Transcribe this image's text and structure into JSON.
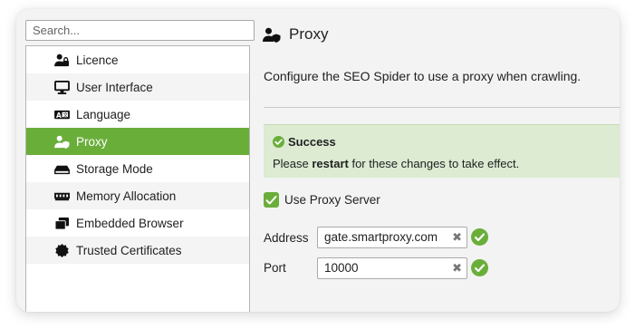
{
  "search": {
    "placeholder": "Search..."
  },
  "sidebar": {
    "items": [
      {
        "label": "Licence",
        "icon": "licence-icon"
      },
      {
        "label": "User Interface",
        "icon": "monitor-icon"
      },
      {
        "label": "Language",
        "icon": "language-icon"
      },
      {
        "label": "Proxy",
        "icon": "proxy-icon",
        "active": true
      },
      {
        "label": "Storage Mode",
        "icon": "storage-icon"
      },
      {
        "label": "Memory Allocation",
        "icon": "memory-icon"
      },
      {
        "label": "Embedded Browser",
        "icon": "browser-icon"
      },
      {
        "label": "Trusted Certificates",
        "icon": "certificate-icon"
      }
    ]
  },
  "main": {
    "title": "Proxy",
    "description": "Configure the SEO Spider to use a proxy when crawling.",
    "alert": {
      "title": "Success",
      "message_prefix": "Please ",
      "message_bold": "restart",
      "message_suffix": " for these changes to take effect."
    },
    "use_proxy": {
      "label": "Use Proxy Server",
      "checked": true
    },
    "address": {
      "label": "Address",
      "value": "gate.smartproxy.com"
    },
    "port": {
      "label": "Port",
      "value": "10000"
    }
  },
  "colors": {
    "accent": "#6aae3a",
    "alert_bg": "#dcebd2"
  }
}
